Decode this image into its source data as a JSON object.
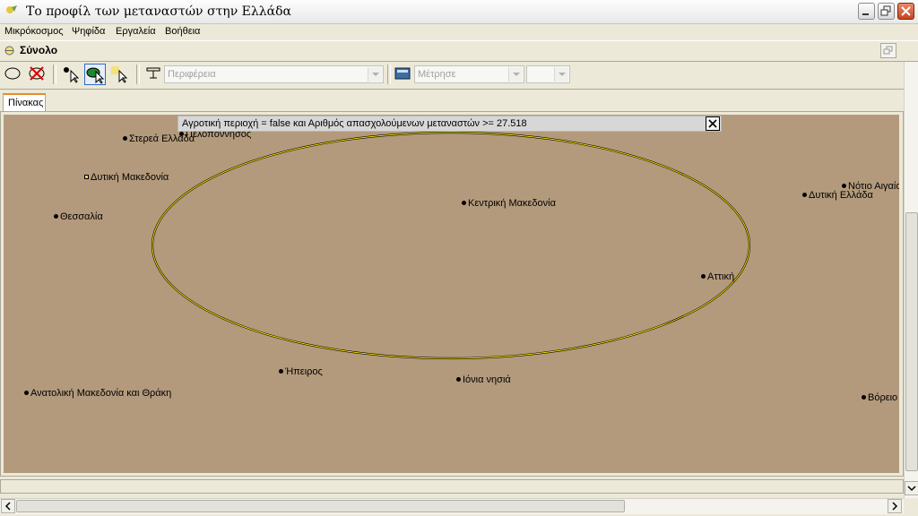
{
  "window": {
    "title": "Το προφίλ των μεταναστών στην Ελλάδα"
  },
  "menu": {
    "items": [
      "Μικρόκοσμος",
      "Ψηφίδα",
      "Εργαλεία",
      "Βοήθεια"
    ]
  },
  "panel": {
    "title": "Σύνολο"
  },
  "toolbar": {
    "attribute_select": "Περιφέρεια",
    "measure_select": "Μέτρησε",
    "measure_value": ""
  },
  "tabs": [
    "Πίνακας"
  ],
  "filter": {
    "text": "Αγροτική περιοχή = false και Αριθμός απασχολούμενων μεταναστών >= 27.518"
  },
  "places": [
    "Πελοπόννησος",
    "Στερεά Ελλάδα",
    "Δυτική Μακεδονία",
    "Θεσσαλία",
    "Κεντρική Μακεδονία",
    "Νότιο Αιγαίο",
    "Δυτική Ελλάδα",
    "Αττική",
    "Ήπειρος",
    "Ιόνια νησιά",
    "Ανατολική Μακεδονία και Θράκη",
    "Βόρειο"
  ],
  "colors": {
    "map_background": "#b39a7c",
    "ellipse_stroke": "#f0e000",
    "tab_accent": "#e68b2c"
  }
}
